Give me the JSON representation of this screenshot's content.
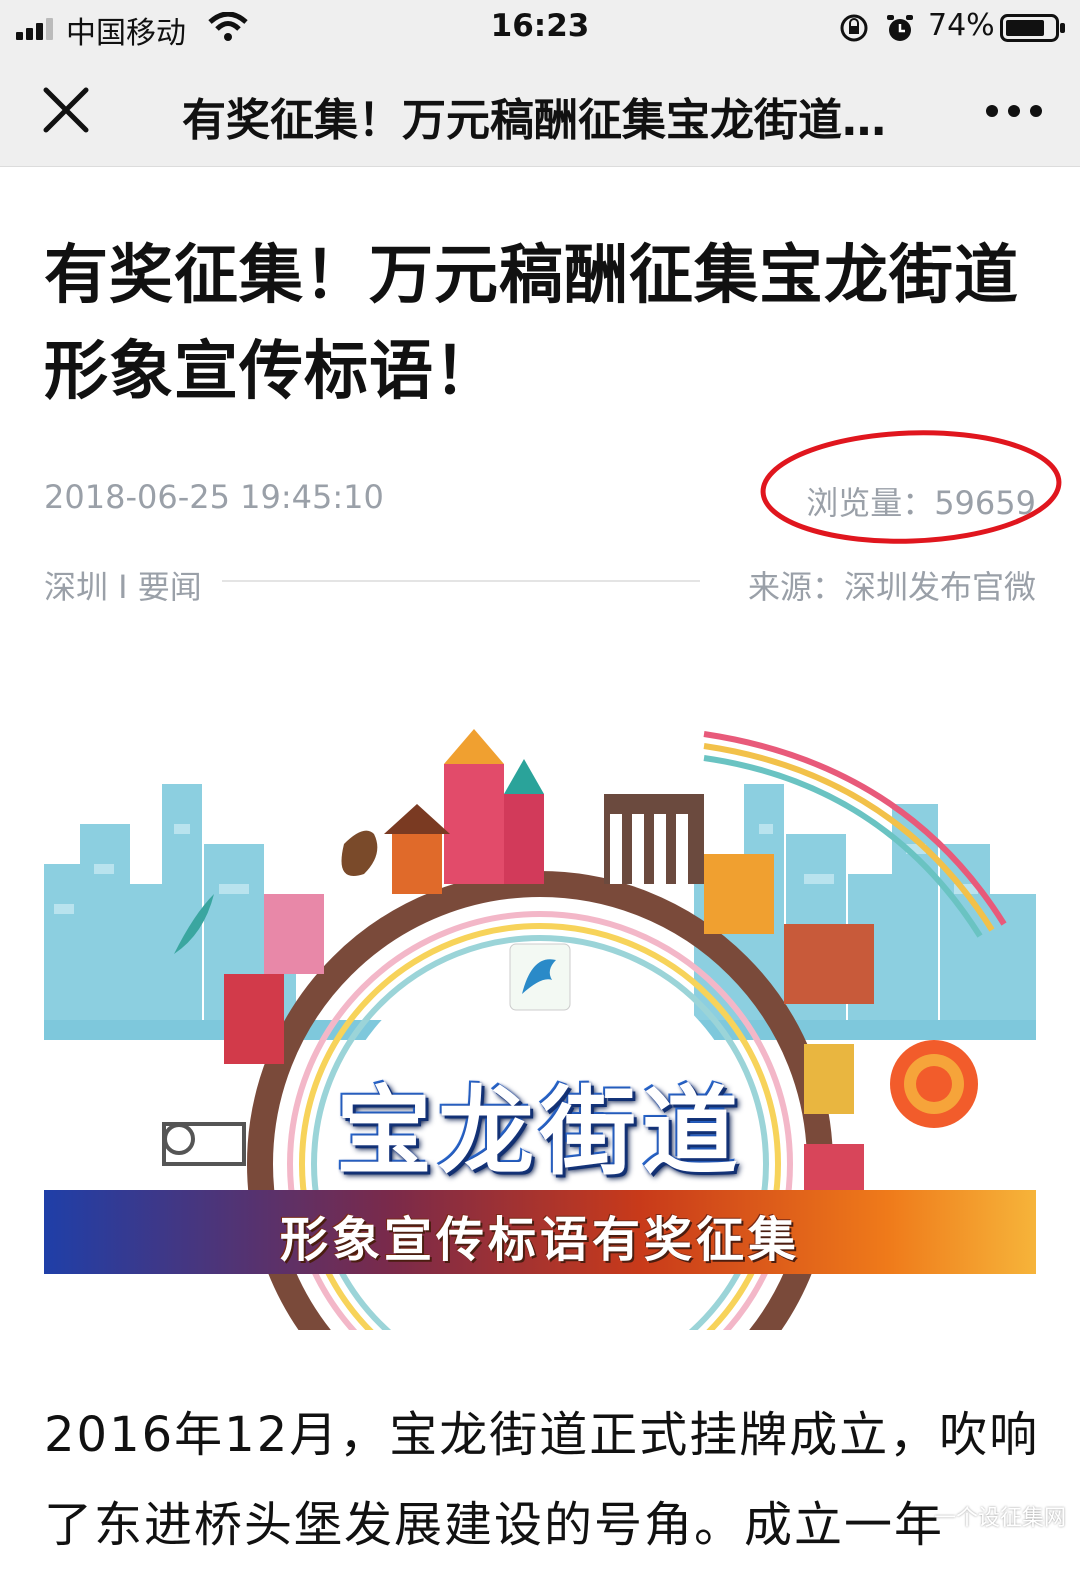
{
  "status_bar": {
    "carrier": "中国移动",
    "time": "16:23",
    "battery": "74%",
    "icons": [
      "signal-icon",
      "wifi-icon",
      "rotation-lock-icon",
      "alarm-icon",
      "battery-icon"
    ]
  },
  "nav": {
    "title": "有奖征集！万元稿酬征集宝龙街道形象宣传标语！",
    "close_icon": "close-icon",
    "more_icon": "more-icon"
  },
  "article": {
    "title": "有奖征集！万元稿酬征集宝龙街道形象宣传标语！",
    "date": "2018-06-25 19:45:10",
    "views": "浏览量：59659",
    "category": "深圳 I 要闻",
    "source": "来源：深圳发布官微",
    "banner": {
      "title": "宝龙街道",
      "subtitle": "形象宣传标语有奖征集"
    },
    "body": "2016年12月，宝龙街道正式挂牌成立，吹响了东进桥头堡发展建设的号角。成立一年"
  },
  "watermark": "一个设征集网",
  "colors": {
    "highlight_circle": "#e0161e",
    "meta_text": "#9aa0a8",
    "bar_bg": "#efefef",
    "banner_sky": "#7ec8dc"
  }
}
